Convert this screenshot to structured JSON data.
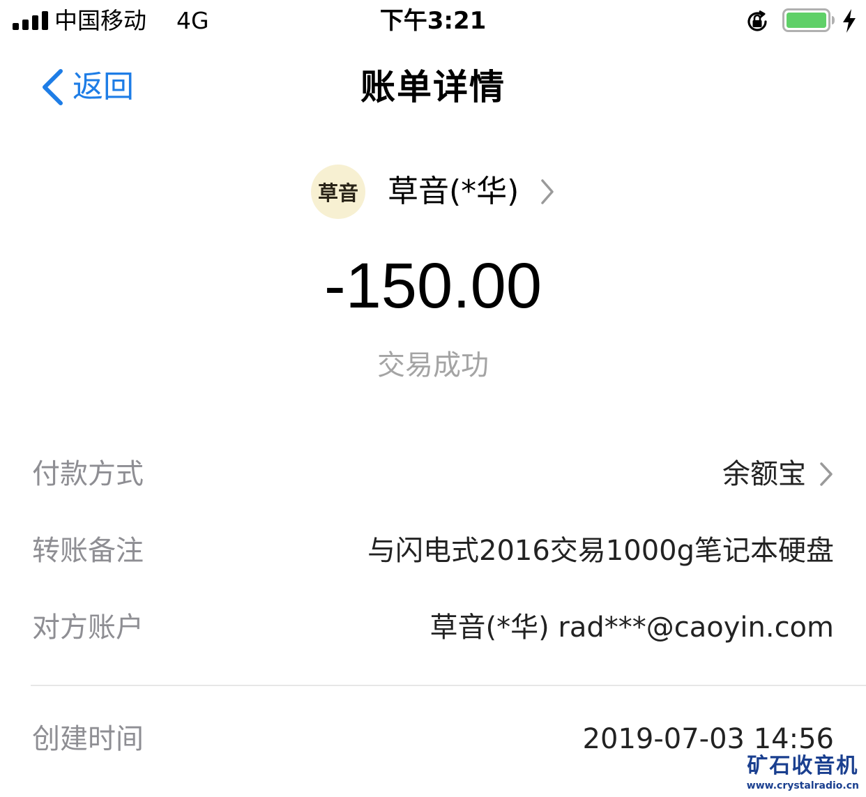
{
  "status_bar": {
    "carrier": "中国移动",
    "network": "4G",
    "time": "下午3:21"
  },
  "nav": {
    "back_label": "返回",
    "title": "账单详情"
  },
  "merchant": {
    "avatar_text": "草音",
    "name": "草音(*华)"
  },
  "transaction": {
    "amount": "-150.00",
    "status": "交易成功"
  },
  "details": {
    "payment_method_label": "付款方式",
    "payment_method_value": "余额宝",
    "note_label": "转账备注",
    "note_value": "与闪电式2016交易1000g笔记本硬盘",
    "account_label": "对方账户",
    "account_value": "草音(*华) rad***@caoyin.com",
    "created_label": "创建时间",
    "created_value": "2019-07-03 14:56"
  },
  "watermark": {
    "logo_text": "矿石收音机",
    "url": "www.crystalradio.cn"
  },
  "colors": {
    "accent": "#1e7de6",
    "label_gray": "#8e8e93",
    "status_gray": "#a4a4a4",
    "battery_green": "#5fd068"
  },
  "icons": [
    "signal-icon",
    "orientation-lock-icon",
    "battery-icon",
    "charging-bolt-icon",
    "back-chevron-icon",
    "chevron-right-icon"
  ]
}
